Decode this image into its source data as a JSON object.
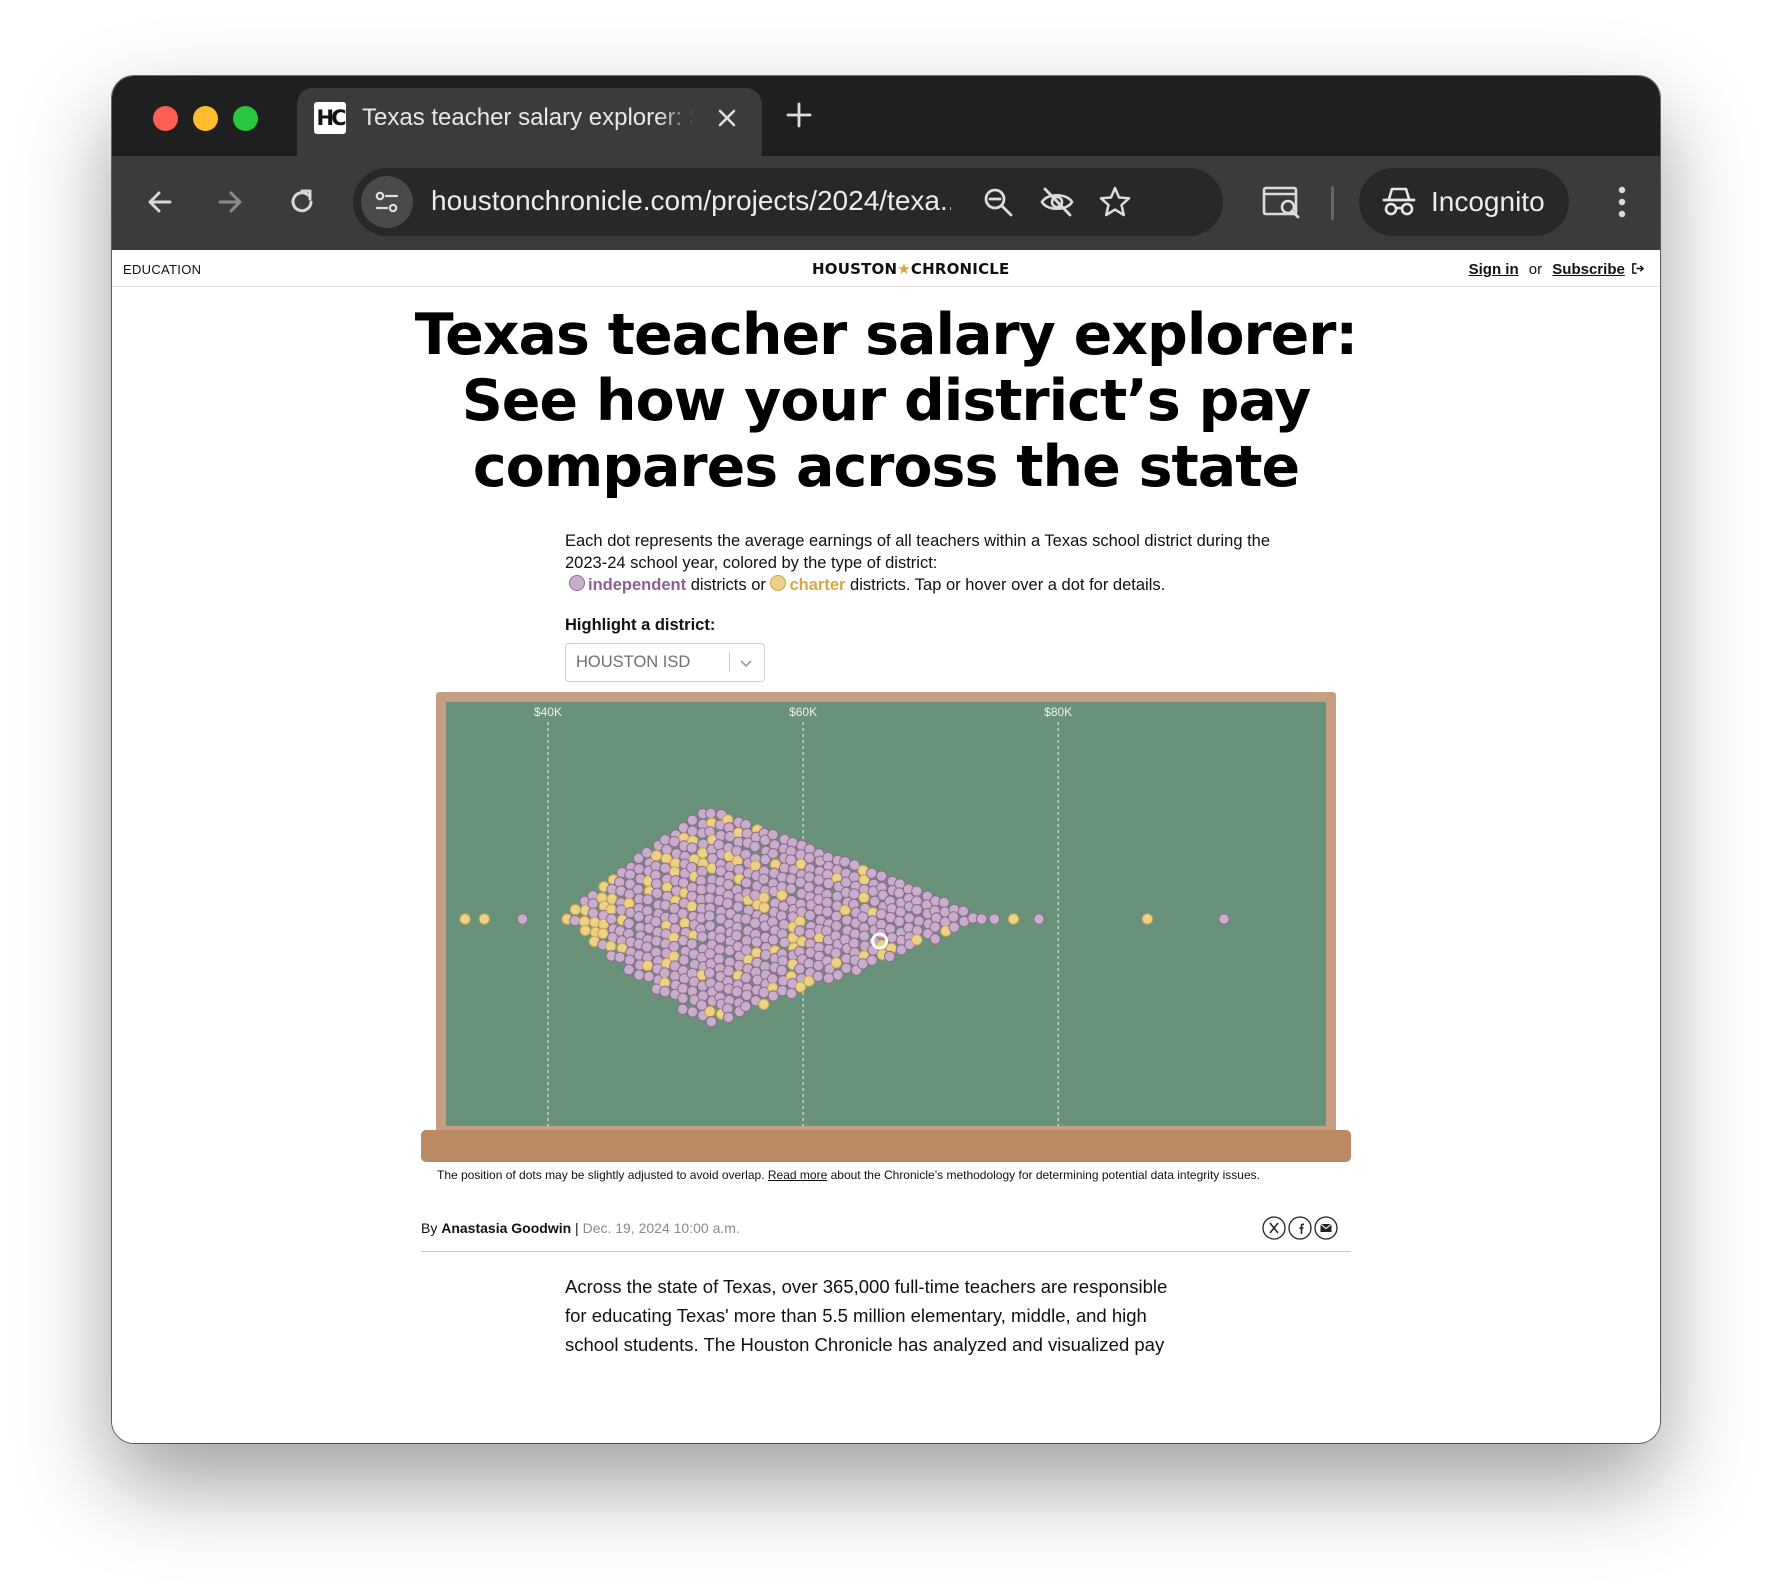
{
  "browser": {
    "tab_title": "Texas teacher salary explorer: See how your district’s pay compares across the state",
    "tab_favicon_text": "HC",
    "url": "houstonchronicle.com/projects/2024/texa...",
    "incognito_label": "Incognito"
  },
  "topbar": {
    "section": "EDUCATION",
    "masthead_left": "HOUSTON",
    "masthead_star": "★",
    "masthead_right": "CHRONICLE",
    "sign_in": "Sign in",
    "or": "or",
    "subscribe": "Subscribe"
  },
  "headline": "Texas teacher salary explorer: See how your district’s pay compares across the state",
  "dek": {
    "intro": "Each dot represents the average earnings of all teachers within a Texas school district during the 2023-24 school year, colored by the type of district:",
    "independent": "independent",
    "between": "districts or",
    "charter": "charter",
    "outro": "districts. Tap or hover over a dot for details."
  },
  "highlight": {
    "label": "Highlight a district:",
    "selected": "HOUSTON ISD"
  },
  "colors": {
    "independent": "#c9aecb",
    "independent_stroke": "#8e6a90",
    "charter": "#ecd288",
    "charter_stroke": "#c9a24e",
    "board": "#68927a",
    "frame": "#c79f80",
    "ledge": "#b98a64"
  },
  "chart_data": {
    "type": "scatter",
    "subtype": "beeswarm",
    "x_axis": {
      "ticks": [
        "$40K",
        "$60K",
        "$80K"
      ],
      "tick_values": [
        40000,
        60000,
        80000
      ],
      "range": [
        32000,
        101000
      ],
      "grid": "dashed"
    },
    "series": [
      {
        "name": "independent"
      },
      {
        "name": "charter"
      }
    ],
    "labeled_outliers": [
      {
        "type": "charter",
        "x": 33500
      },
      {
        "type": "charter",
        "x": 35000
      },
      {
        "type": "independent",
        "x": 38000
      },
      {
        "type": "independent",
        "x": 74000
      },
      {
        "type": "independent",
        "x": 75000
      },
      {
        "type": "charter",
        "x": 76500
      },
      {
        "type": "independent",
        "x": 78500
      },
      {
        "type": "charter",
        "x": 87000
      },
      {
        "type": "independent",
        "x": 93000
      }
    ],
    "highlighted": {
      "name": "HOUSTON ISD",
      "x": 66000
    }
  },
  "note": {
    "before": "The position of dots may be slightly adjusted to avoid overlap.",
    "link": "Read more",
    "after": "about the Chronicle’s methodology for determining potential data integrity issues."
  },
  "byline": {
    "by": "By",
    "author": "Anastasia Goodwin",
    "sep": "|",
    "date": "Dec. 19, 2024 10:00 a.m."
  },
  "body": "Across the state of Texas, over 365,000 full-time teachers are responsible for educating Texas' more than 5.5 million elementary, middle, and high school students. The Houston Chronicle has analyzed and visualized pay"
}
